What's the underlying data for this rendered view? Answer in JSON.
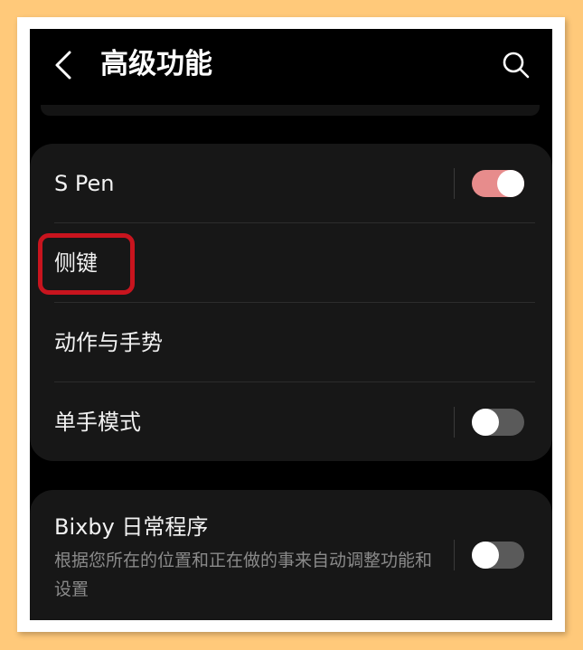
{
  "header": {
    "title": "高级功能",
    "back_icon": "chevron-left-icon",
    "search_icon": "search-icon"
  },
  "settings_group_1": {
    "items": [
      {
        "label": "S Pen",
        "toggle": "on"
      },
      {
        "label": "侧键"
      },
      {
        "label": "动作与手势"
      },
      {
        "label": "单手模式",
        "toggle": "off"
      }
    ]
  },
  "settings_group_2": {
    "bixby": {
      "title": "Bixby 日常程序",
      "description": "根据您所在的位置和正在做的事来自动调整功能和设置",
      "toggle": "off"
    }
  },
  "colors": {
    "toggle_on": "#e78c8c",
    "toggle_off": "#5a5a5a",
    "highlight": "#c8141e",
    "background_outer": "#ffc97a"
  }
}
